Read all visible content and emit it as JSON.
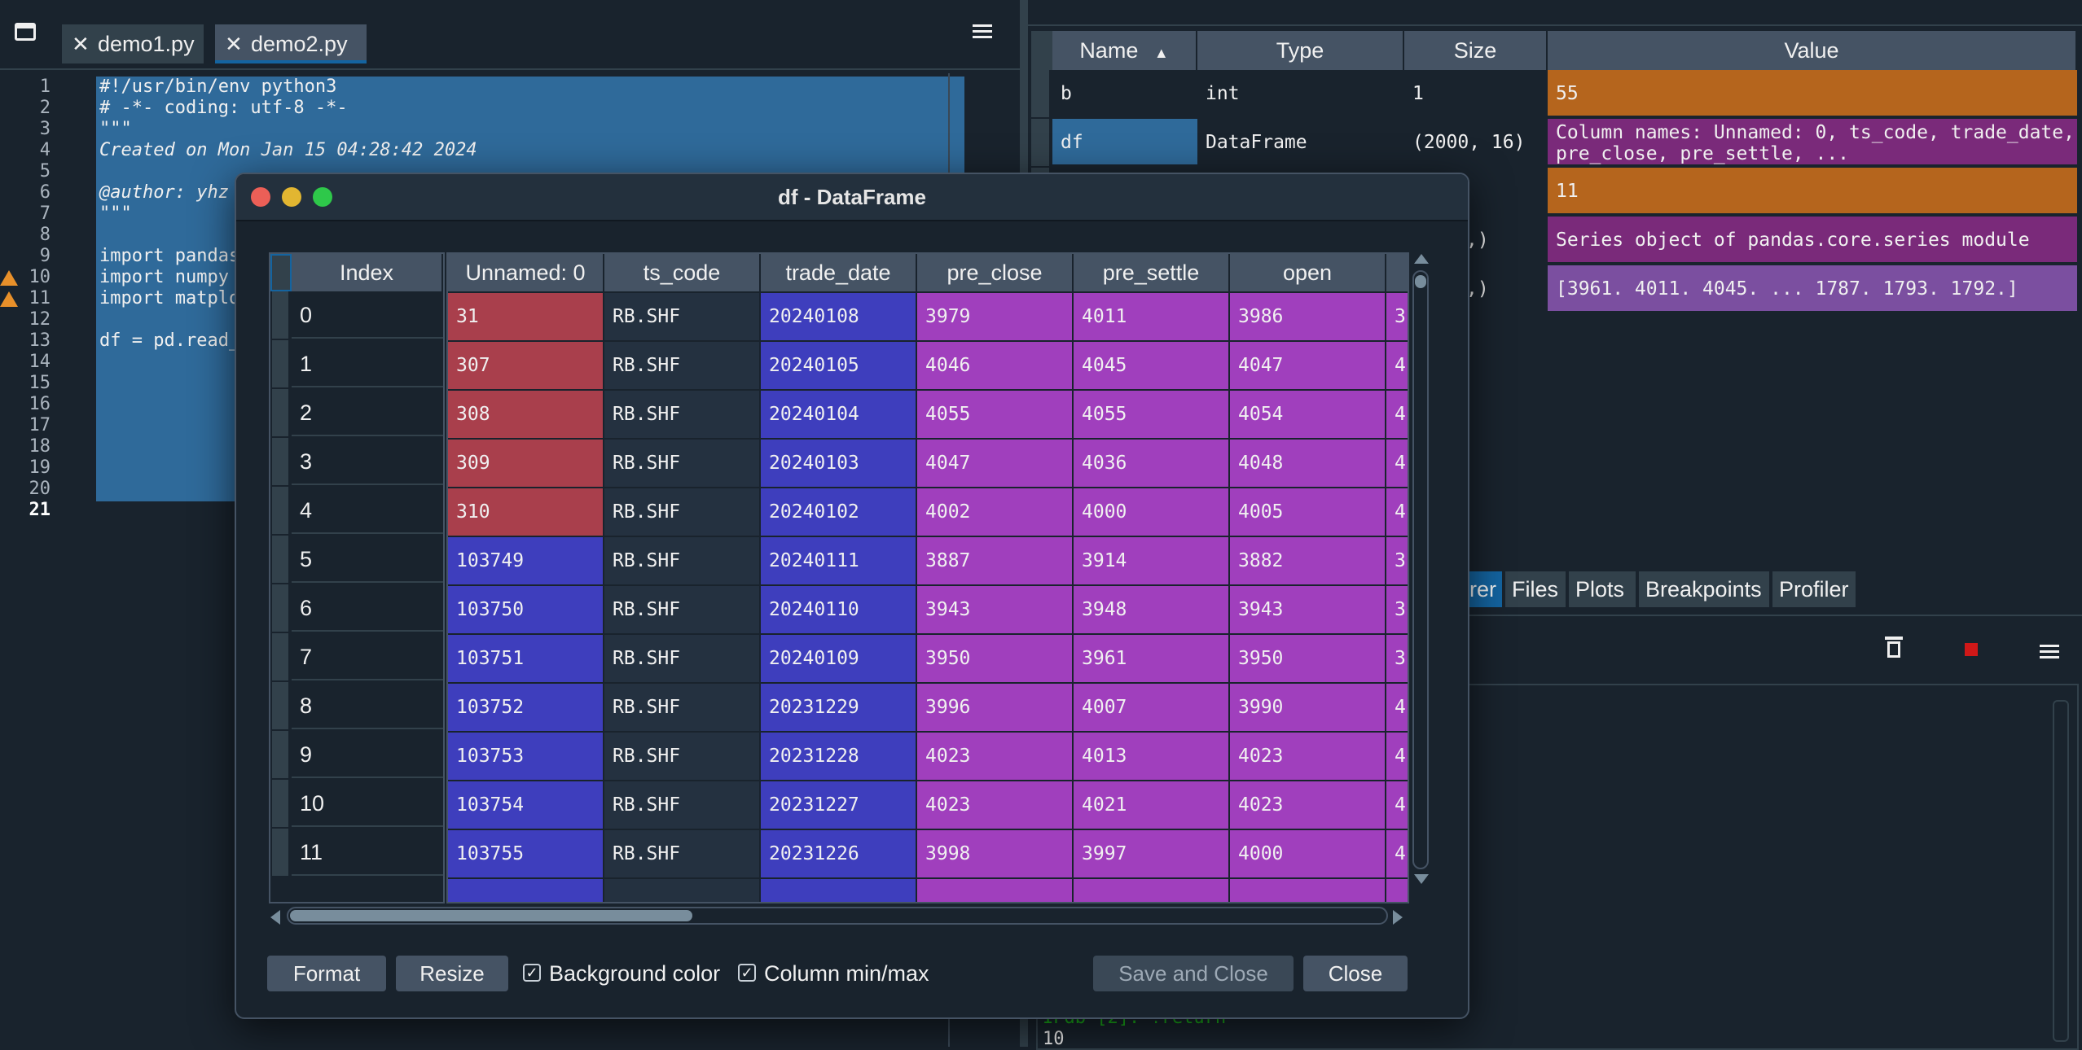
{
  "editor": {
    "tabs": [
      {
        "label": "demo1.py"
      },
      {
        "label": "demo2.py"
      }
    ],
    "line_numbers": [
      "1",
      "2",
      "3",
      "4",
      "5",
      "6",
      "7",
      "8",
      "9",
      "10",
      "11",
      "12",
      "13",
      "14",
      "15",
      "16",
      "17",
      "18",
      "19",
      "20",
      "21"
    ],
    "code_lines": [
      "#!/usr/bin/env python3",
      "# -*- coding: utf-8 -*-",
      "\"\"\"",
      "Created on Mon Jan 15 04:28:42 2024",
      "",
      "@author: yhz",
      "\"\"\"",
      "",
      "import pandas",
      "import numpy",
      "import matplo",
      "",
      "df = pd.read_"
    ]
  },
  "variable_explorer": {
    "columns": [
      "Name",
      "Type",
      "Size",
      "Value"
    ],
    "rows": [
      {
        "name": "b",
        "type": "int",
        "size": "1",
        "value": "55"
      },
      {
        "name": "df",
        "type": "DataFrame",
        "size": "(2000, 16)",
        "value": "Column names: Unnamed: 0, ts_code, trade_date, pre_close, pre_settle, ..."
      },
      {
        "name": "",
        "type": "",
        "size": "",
        "value": "11"
      },
      {
        "name": "",
        "type": "",
        "size": ",)",
        "value": "Series object of pandas.core.series module"
      },
      {
        "name": "",
        "type": "",
        "size": ",)",
        "value": "[3961. 4011. 4045. ... 1787. 1793. 1792.]"
      }
    ],
    "colors": {
      "int": "#b5651d",
      "dataframe": "#7a2a7a",
      "series": "#9a3c9a",
      "array": "#7b4fa0"
    }
  },
  "pane_tabs": [
    {
      "label": "rer"
    },
    {
      "label": "Files"
    },
    {
      "label": "Plots"
    },
    {
      "label": "Breakpoints"
    },
    {
      "label": "Profiler"
    }
  ],
  "console": {
    "prompt_line": "IPdb [2]: !return",
    "output_line": "10"
  },
  "dialog": {
    "title": "df - DataFrame",
    "index_header": "Index",
    "columns": [
      "Unnamed: 0",
      "ts_code",
      "trade_date",
      "pre_close",
      "pre_settle",
      "open"
    ],
    "index": [
      "0",
      "1",
      "2",
      "3",
      "4",
      "5",
      "6",
      "7",
      "8",
      "9",
      "10",
      "11"
    ],
    "rows": [
      [
        "31",
        "RB.SHF",
        "20240108",
        "3979",
        "4011",
        "3986",
        "3"
      ],
      [
        "307",
        "RB.SHF",
        "20240105",
        "4046",
        "4045",
        "4047",
        "4"
      ],
      [
        "308",
        "RB.SHF",
        "20240104",
        "4055",
        "4055",
        "4054",
        "4"
      ],
      [
        "309",
        "RB.SHF",
        "20240103",
        "4047",
        "4036",
        "4048",
        "4"
      ],
      [
        "310",
        "RB.SHF",
        "20240102",
        "4002",
        "4000",
        "4005",
        "4"
      ],
      [
        "103749",
        "RB.SHF",
        "20240111",
        "3887",
        "3914",
        "3882",
        "3"
      ],
      [
        "103750",
        "RB.SHF",
        "20240110",
        "3943",
        "3948",
        "3943",
        "3"
      ],
      [
        "103751",
        "RB.SHF",
        "20240109",
        "3950",
        "3961",
        "3950",
        "3"
      ],
      [
        "103752",
        "RB.SHF",
        "20231229",
        "3996",
        "4007",
        "3990",
        "4"
      ],
      [
        "103753",
        "RB.SHF",
        "20231228",
        "4023",
        "4013",
        "4023",
        "4"
      ],
      [
        "103754",
        "RB.SHF",
        "20231227",
        "4023",
        "4021",
        "4023",
        "4"
      ],
      [
        "103755",
        "RB.SHF",
        "20231226",
        "3998",
        "3997",
        "4000",
        "4"
      ]
    ],
    "buttons": {
      "format": "Format",
      "resize": "Resize",
      "save_close": "Save and Close",
      "close": "Close"
    },
    "checkboxes": {
      "background_color": "Background color",
      "column_minmax": "Column min/max"
    },
    "colors": {
      "red": "#a93f4c",
      "blue": "#3e3ebd",
      "dark": "#243140",
      "magenta": "#a03fbd"
    }
  }
}
